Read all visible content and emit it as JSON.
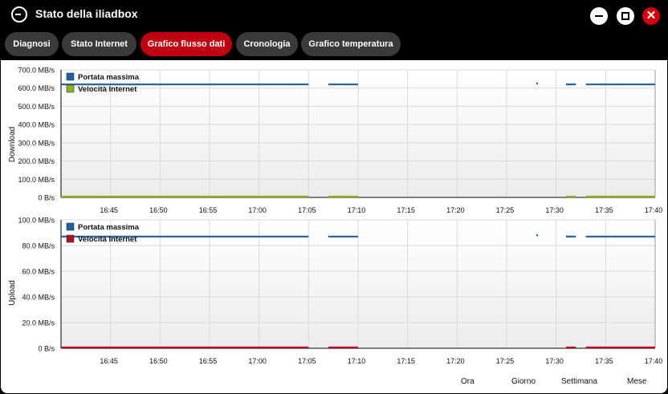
{
  "window": {
    "title": "Stato della iliadbox"
  },
  "tabs": [
    {
      "label": "Diagnosi",
      "active": false
    },
    {
      "label": "Stato Internet",
      "active": false
    },
    {
      "label": "Grafico flusso dati",
      "active": true
    },
    {
      "label": "Cronologia",
      "active": false
    },
    {
      "label": "Grafico temperatura",
      "active": false
    }
  ],
  "window_controls": {
    "close": "✕"
  },
  "range_buttons": [
    "Ora",
    "Giorno",
    "Settimana",
    "Mese"
  ],
  "colors": {
    "accent": "#c00010",
    "max_line": "#1f5f9e",
    "download_speed": "#8fb020",
    "upload_speed": "#b01020"
  },
  "chart_data": [
    {
      "type": "line",
      "ylabel": "Download",
      "ylim": [
        0,
        700
      ],
      "y_ticks": [
        "0 B/s",
        "100.0 MB/s",
        "200.0 MB/s",
        "300.0 MB/s",
        "400.0 MB/s",
        "500.0 MB/s",
        "600.0 MB/s",
        "700.0 MB/s"
      ],
      "x_ticks": [
        "16:45",
        "16:50",
        "16:55",
        "17:00",
        "17:05",
        "17:10",
        "17:15",
        "17:20",
        "17:25",
        "17:30",
        "17:35",
        "17:40"
      ],
      "legend": [
        "Portata massima",
        "Velocità Internet"
      ],
      "grid": true,
      "series": [
        {
          "name": "Portata massima",
          "segments": [
            [
              "16:40",
              "17:05",
              620
            ],
            [
              "17:07",
              "17:10",
              620
            ],
            [
              "17:28",
              "17:28",
              625
            ],
            [
              "17:31",
              "17:32",
              620
            ],
            [
              "17:33",
              "17:40",
              620
            ]
          ]
        },
        {
          "name": "Velocità Internet",
          "segments": [
            [
              "16:40",
              "17:05",
              0
            ],
            [
              "17:07",
              "17:10",
              0
            ],
            [
              "17:31",
              "17:32",
              0
            ],
            [
              "17:33",
              "17:40",
              0
            ]
          ]
        }
      ]
    },
    {
      "type": "line",
      "ylabel": "Upload",
      "ylim": [
        0,
        100
      ],
      "y_ticks": [
        "0 B/s",
        "20.0 MB/s",
        "40.0 MB/s",
        "60.0 MB/s",
        "80.0 MB/s",
        "100.0 MB/s"
      ],
      "x_ticks": [
        "16:45",
        "16:50",
        "16:55",
        "17:00",
        "17:05",
        "17:10",
        "17:15",
        "17:20",
        "17:25",
        "17:30",
        "17:35",
        "17:40"
      ],
      "legend": [
        "Portata massima",
        "Velocità Internet"
      ],
      "grid": true,
      "series": [
        {
          "name": "Portata massima",
          "segments": [
            [
              "16:40",
              "17:05",
              87
            ],
            [
              "17:07",
              "17:10",
              87
            ],
            [
              "17:28",
              "17:28",
              88
            ],
            [
              "17:31",
              "17:32",
              87
            ],
            [
              "17:33",
              "17:40",
              87
            ]
          ]
        },
        {
          "name": "Velocità Internet",
          "segments": [
            [
              "16:40",
              "17:05",
              0
            ],
            [
              "17:07",
              "17:10",
              0
            ],
            [
              "17:31",
              "17:32",
              0
            ],
            [
              "17:33",
              "17:40",
              0
            ]
          ]
        }
      ]
    }
  ]
}
